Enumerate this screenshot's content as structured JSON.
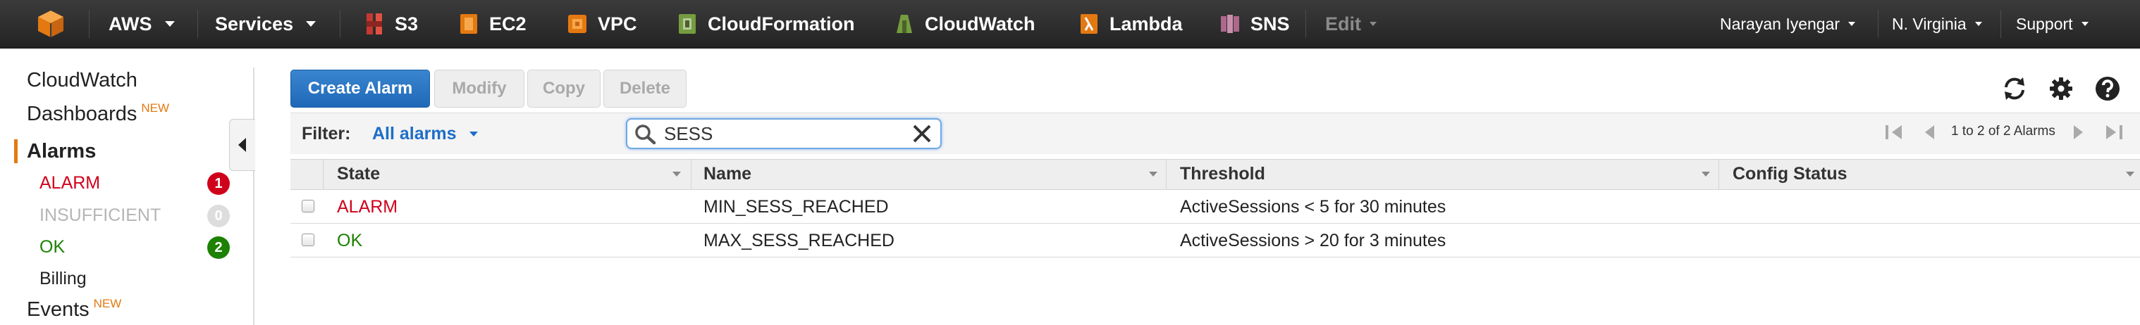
{
  "topnav": {
    "aws_label": "AWS",
    "services_label": "Services",
    "services": [
      {
        "label": "S3",
        "color": "#c7372f"
      },
      {
        "label": "EC2",
        "color": "#e47911"
      },
      {
        "label": "VPC",
        "color": "#e47911"
      },
      {
        "label": "CloudFormation",
        "color": "#759c3e"
      },
      {
        "label": "CloudWatch",
        "color": "#759c3e"
      },
      {
        "label": "Lambda",
        "color": "#e47911"
      },
      {
        "label": "SNS",
        "color": "#ad688b"
      }
    ],
    "edit_label": "Edit",
    "user_label": "Narayan Iyengar",
    "region_label": "N. Virginia",
    "support_label": "Support"
  },
  "sidebar": {
    "cloudwatch": "CloudWatch",
    "dashboards": "Dashboards",
    "new_badge": "NEW",
    "alarms": "Alarms",
    "states": [
      {
        "label": "ALARM",
        "count": "1",
        "color": "#d0021b",
        "badge_color": "#d0021b"
      },
      {
        "label": "INSUFFICIENT",
        "count": "0",
        "color": "#b5b5b5",
        "badge_color": "#dddddd"
      },
      {
        "label": "OK",
        "count": "2",
        "color": "#1d8102",
        "badge_color": "#1d8102"
      }
    ],
    "billing": "Billing",
    "events": "Events",
    "events_badge": "NEW"
  },
  "toolbar": {
    "create_alarm": "Create Alarm",
    "modify": "Modify",
    "copy": "Copy",
    "delete": "Delete",
    "icons": [
      "refresh-icon",
      "gear-icon",
      "help-icon"
    ]
  },
  "filter": {
    "label": "Filter:",
    "selected": "All alarms",
    "search_value": "SESS",
    "pager_text": "1 to 2 of 2 Alarms"
  },
  "table": {
    "columns": [
      "State",
      "Name",
      "Threshold",
      "Config Status"
    ],
    "rows": [
      {
        "state": "ALARM",
        "state_color": "#d0021b",
        "name": "MIN_SESS_REACHED",
        "threshold": "ActiveSessions < 5 for 30 minutes",
        "config_status": ""
      },
      {
        "state": "OK",
        "state_color": "#1d8102",
        "name": "MAX_SESS_REACHED",
        "threshold": "ActiveSessions > 20 for 3 minutes",
        "config_status": ""
      }
    ]
  }
}
